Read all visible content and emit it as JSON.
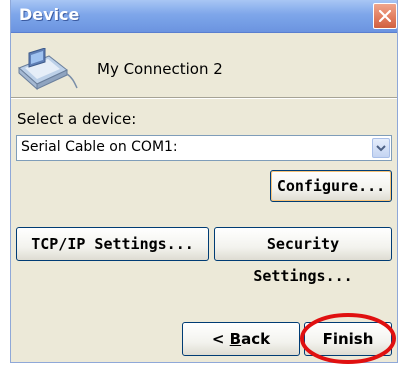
{
  "window": {
    "title": "Device"
  },
  "connection": {
    "name": "My Connection 2",
    "icon": "computer-connection-icon"
  },
  "device_select": {
    "label": "Select a device:",
    "value": "Serial Cable on COM1:"
  },
  "buttons": {
    "configure": "Configure...",
    "tcpip": "TCP/IP Settings...",
    "security": "Security Settings...",
    "back_prefix": "< ",
    "back_mnemonic": "B",
    "back_rest": "ack",
    "finish": "Finish"
  },
  "colors": {
    "titlebar": "#7ea6ea",
    "dialog_background": "#ece9d8",
    "highlight_circle": "#e01010"
  }
}
